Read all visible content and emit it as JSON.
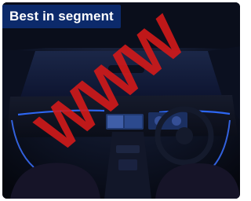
{
  "badge": {
    "label": "Best in segment"
  },
  "image": {
    "subject": "car-interior-dashboard-ambient-lighting",
    "watermark_color": "#d31a1a",
    "ambient_light_color": "#2f6bff"
  }
}
